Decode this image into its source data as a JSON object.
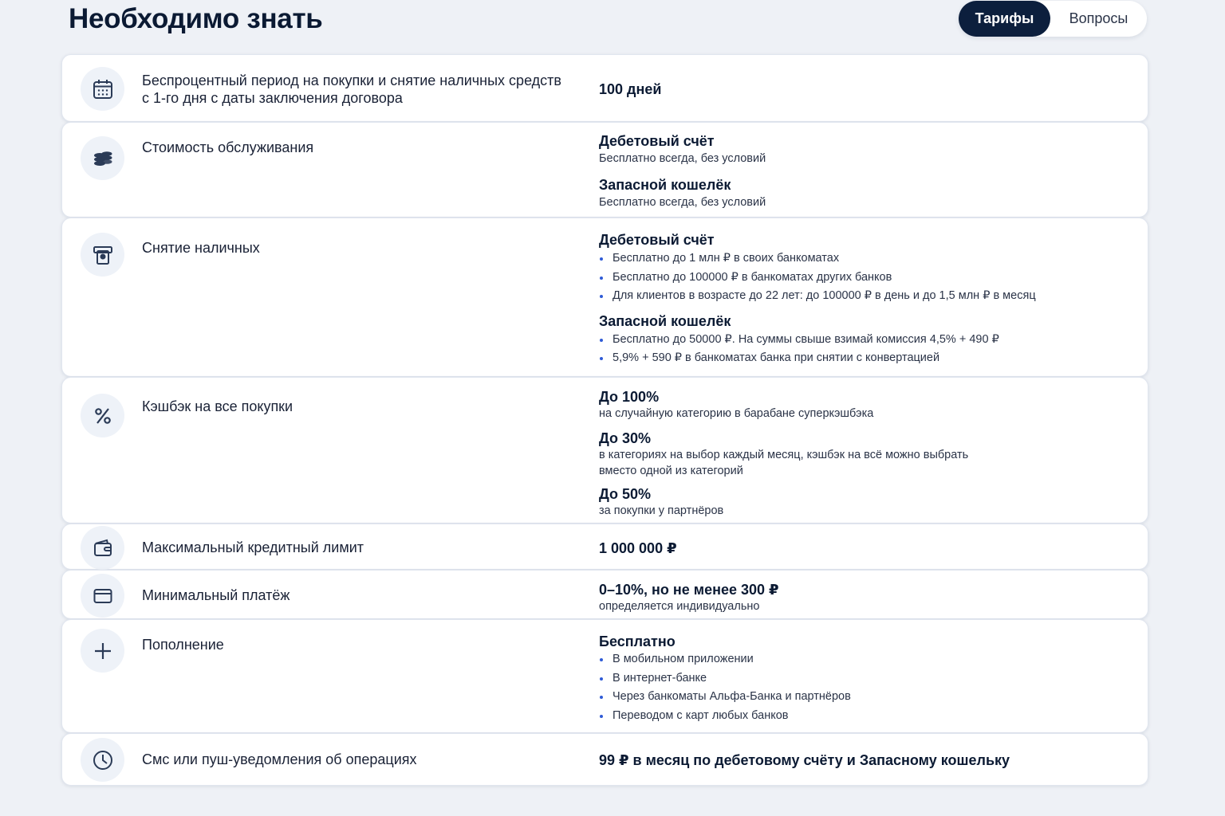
{
  "header": {
    "title": "Необходимо знать",
    "tabs": [
      {
        "label": "Тарифы",
        "active": true
      },
      {
        "label": "Вопросы",
        "active": false
      }
    ]
  },
  "colors": {
    "accent_dark": "#0c1f3d",
    "bullet": "#2f5bd6",
    "icon_stroke": "#2b3b57",
    "background": "#eef1f6"
  },
  "rows": [
    {
      "icon": "calendar-icon",
      "label_line1": "Беспроцентный период на покупки и снятие наличных средств",
      "label_line2": "с 1-го дня с даты заключения договора",
      "value": "100 дней"
    },
    {
      "icon": "coins-icon",
      "label": "Стоимость обслуживания",
      "groups": [
        {
          "title": "Дебетовый счёт",
          "text": "Бесплатно всегда, без условий"
        },
        {
          "title": "Запасной кошелёк",
          "text": "Бесплатно всегда, без условий"
        }
      ]
    },
    {
      "icon": "atm-icon",
      "label": "Снятие наличных",
      "groups": [
        {
          "title": "Дебетовый счёт",
          "items": [
            "Бесплатно до 1 млн ₽ в своих банкоматах",
            "Бесплатно до 100000 ₽ в банкоматах других банков",
            "Для клиентов в возрасте до 22 лет: до 100000 ₽ в день и до 1,5 млн ₽ в месяц"
          ]
        },
        {
          "title": "Запасной кошелёк",
          "items": [
            "Бесплатно до 50000 ₽. На суммы свыше взимай комиссия 4,5% + 490 ₽",
            "5,9% + 590 ₽ в банкоматах банка при снятии с конвертацией"
          ]
        }
      ]
    },
    {
      "icon": "percent-icon",
      "label": "Кэшбэк на все покупки",
      "groups": [
        {
          "title": "До 100%",
          "text": "на случайную категорию в барабане суперкэшбэка"
        },
        {
          "title": "До 30%",
          "text_line1": "в категориях на выбор каждый месяц, кэшбэк на всё можно выбрать",
          "text_line2": "вместо одной из категорий"
        },
        {
          "title": "До 50%",
          "text": "за покупки у партнёров"
        }
      ]
    },
    {
      "icon": "wallet-icon",
      "label": "Максимальный кредитный лимит",
      "value": "1 000 000 ₽"
    },
    {
      "icon": "card-icon",
      "label": "Минимальный платёж",
      "value": "0–10%, но не менее 300 ₽",
      "note": "определяется индивидуально"
    },
    {
      "icon": "plus-icon",
      "label": "Пополнение",
      "groups": [
        {
          "title": "Бесплатно",
          "items": [
            "В мобильном приложении",
            "В интернет-банке",
            "Через банкоматы Альфа-Банка и партнёров",
            "Переводом с карт любых банков"
          ]
        }
      ]
    },
    {
      "icon": "clock-icon",
      "label": "Смс или пуш-уведомления об операциях",
      "value": "99 ₽ в месяц по дебетовому счёту и Запасному кошельку"
    }
  ]
}
